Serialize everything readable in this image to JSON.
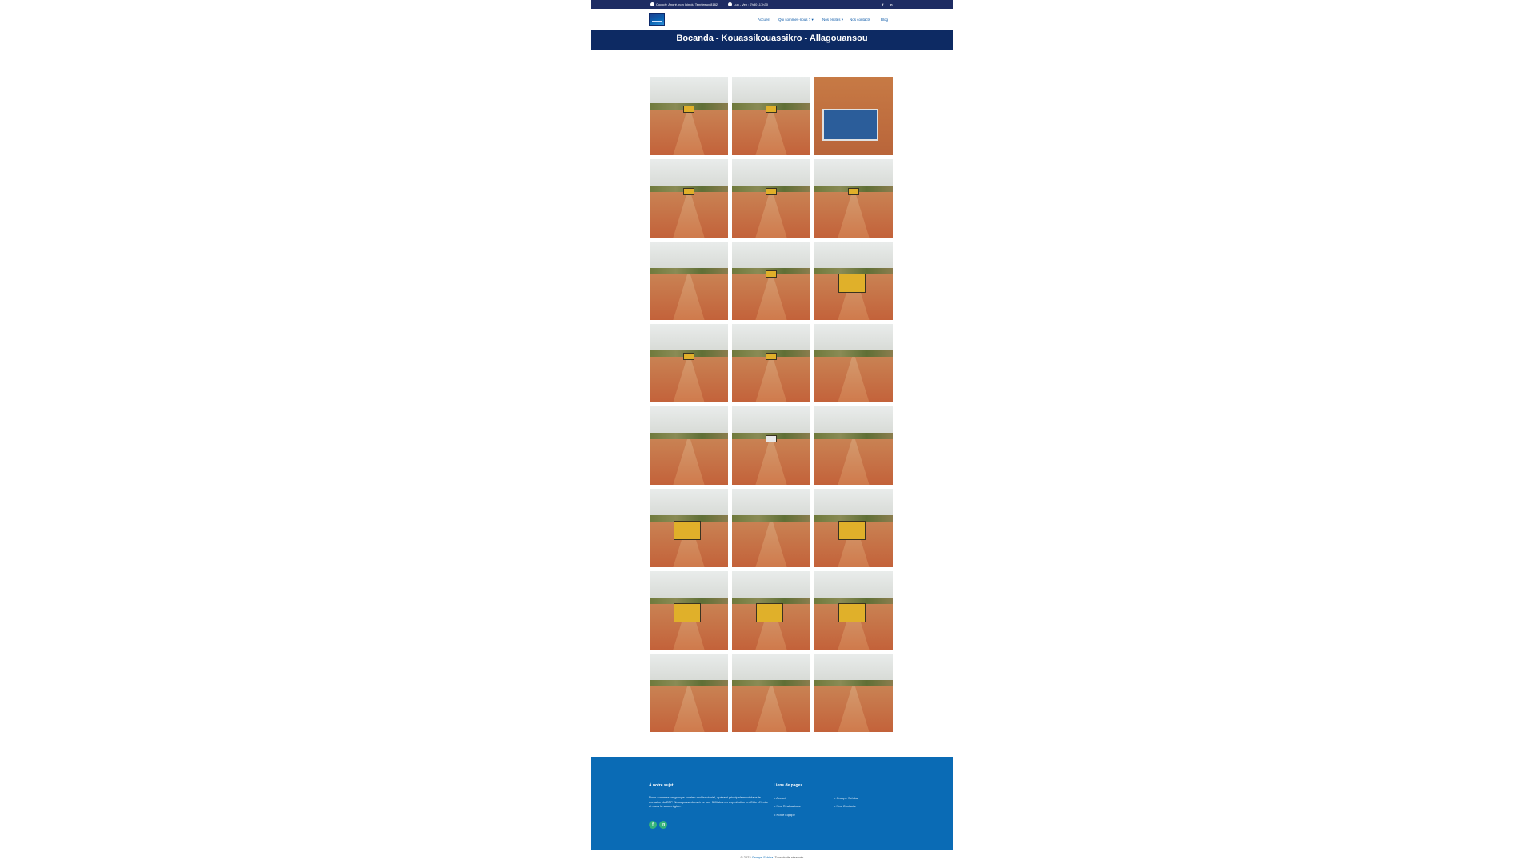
{
  "topbar": {
    "address": "Cocody, Angré, non loin du Tenrileeux 8182",
    "hours": "Lun - Ven : 7h30 -17h30",
    "facebook_icon": "f",
    "linkedin_icon": "in"
  },
  "nav": {
    "items": [
      "Accueil",
      "Qui sommes-nous ? ▾",
      "Nos entités ▾",
      "Nos contacts",
      "Blog"
    ]
  },
  "banner": {
    "title": "Bocanda - Kouassikouassikro - Allagouansou"
  },
  "gallery": {
    "photo_count": 24,
    "icons": [
      "grader",
      "grader",
      "site-compound",
      "grader",
      "grader",
      "grader",
      "road",
      "grader",
      "roller",
      "grader",
      "grader",
      "road",
      "road",
      "truck",
      "road",
      "bulldozer",
      "road",
      "loader",
      "excavator",
      "excavator",
      "excavator",
      "road",
      "road",
      "road"
    ]
  },
  "footer": {
    "about_title": "À notre sujet",
    "about_text": "Nous sommes un groupe ivoirien multisectoriel, opérant principalement dans le domaine du BTP. Nous possédons à ce jour 5 filiales en exploitation en Côte d'Ivoire et dans la sous-région.",
    "links_title": "Liens de pages",
    "links_col1": [
      "• Accueil",
      "• Nos Réalisations",
      "• Notre Equipe"
    ],
    "links_col2": [
      "• Groupe Schiba",
      "• Nos Contacts"
    ],
    "social": [
      "f",
      "in"
    ]
  },
  "copyright": {
    "prefix": "© 2023",
    "brand": "Groupe Schiba",
    "suffix": ". Tous droits réservés"
  },
  "colors": {
    "topbar": "#1e2c63",
    "banner": "#0d2a63",
    "footer": "#0a6bb5",
    "nav_link": "#0d5aa8",
    "soil": "#c3623a"
  }
}
